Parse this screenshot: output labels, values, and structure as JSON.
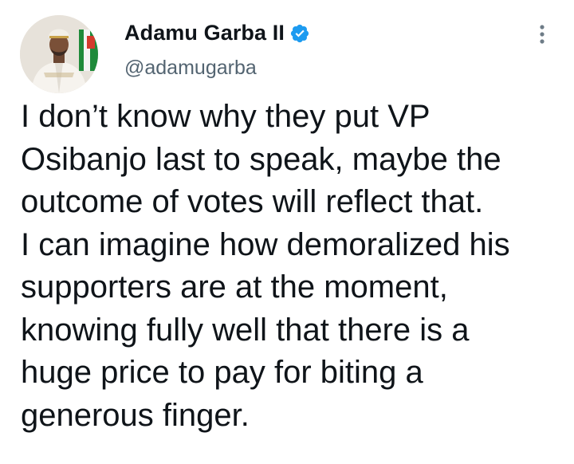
{
  "tweet": {
    "author": {
      "display_name": "Adamu Garba II",
      "handle": "@adamugarba",
      "verified_icon": "verified-badge-icon",
      "verified_color": "#1d9bf0"
    },
    "more_icon": "vertical-ellipsis-icon",
    "text": "I don’t know why they put VP\nOsibanjo last to speak, maybe the\noutcome of votes will reflect that.\nI can imagine how demoralized his\nsupporters are at the moment,\nknowing fully well that there is a\nhuge price to pay for biting a\ngenerous finger."
  },
  "colors": {
    "text_primary": "#0f1419",
    "text_secondary": "#536471",
    "accent": "#1d9bf0"
  }
}
